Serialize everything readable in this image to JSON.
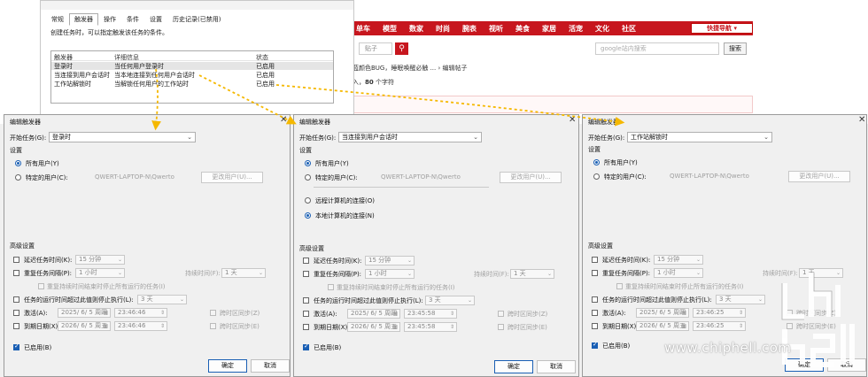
{
  "forum": {
    "nav_items": [
      "单车",
      "模型",
      "数家",
      "时尚",
      "腕表",
      "视听",
      "美食",
      "家居",
      "活宠",
      "文化",
      "社区"
    ],
    "quick_nav": "快捷导航",
    "search_placeholder": "贴子",
    "search_icon": "search-icon",
    "google_placeholder": "google站内搜索",
    "search_button": "搜索",
    "breadcrumb": "蓝颜色BUG，睡眠唤醒必触 ... › 编辑帖子",
    "char_count_prefix": "入",
    "char_count_value": "80",
    "char_count_suffix": "个字符",
    "accent_color": "#c7161e"
  },
  "props_window": {
    "tabs": [
      "常规",
      "触发器",
      "操作",
      "条件",
      "设置",
      "历史记录(已禁用)"
    ],
    "active_tab": "触发器",
    "description": "创建任务时，可以指定触发该任务的条件。",
    "columns": [
      "触发器",
      "详细信息",
      "状态"
    ],
    "rows": [
      {
        "trigger": "登录时",
        "detail": "当任何用户登录时",
        "status": "已启用"
      },
      {
        "trigger": "当连接到用户会话时",
        "detail": "当本地连接到任何用户会话时",
        "status": "已启用"
      },
      {
        "trigger": "工作站解锁时",
        "detail": "当解锁任何用户的工作站时",
        "status": "已启用"
      }
    ]
  },
  "dialogs": [
    {
      "title": "编辑触发器",
      "start_label": "开始任务(G):",
      "start_value": "登录时",
      "settings_label": "设置",
      "any_user": "所有用户(Y)",
      "specific_user": "特定的用户(C):",
      "user_name": "QWERT-LAPTOP-N\\Qwerto",
      "change_user": "更改用户(U)...",
      "advanced": "高级设置",
      "delay_label": "延迟任务时间(K):",
      "delay_value": "15 分钟",
      "repeat_label": "重复任务间隔(P):",
      "repeat_value": "1 小时",
      "duration_label": "持续时间(F):",
      "duration_value": "1 天",
      "stop_all": "重复持续时间结束时停止所有运行的任务(I)",
      "stop_if_label": "任务的运行时间超过此值则停止执行(L):",
      "stop_if_value": "3 天",
      "activate_label": "激活(A):",
      "activate_date": "2025/ 6/ 5 周四",
      "activate_time": "23:46:46",
      "expire_label": "到期日期(X):",
      "expire_date": "2026/ 6/ 5 周五",
      "expire_time": "23:46:46",
      "sync_zone": "跨时区同步(Z)",
      "sync_zone2": "跨时区同步(E)",
      "enabled": "已启用(B)",
      "ok": "确定",
      "cancel": "取消"
    },
    {
      "title": "编辑触发器",
      "start_label": "开始任务(G):",
      "start_value": "当连接到用户会话时",
      "settings_label": "设置",
      "any_user": "所有用户(Y)",
      "specific_user": "特定的用户(C):",
      "user_name": "QWERT-LAPTOP-N\\Qwerto",
      "change_user": "更改用户(U)...",
      "remote": "远程计算机的连接(O)",
      "local": "本地计算机的连接(N)",
      "advanced": "高级设置",
      "delay_label": "延迟任务时间(K):",
      "delay_value": "15 分钟",
      "repeat_label": "重复任务间隔(P):",
      "repeat_value": "1 小时",
      "duration_label": "持续时间(F):",
      "duration_value": "1 天",
      "stop_all": "重复持续时间结束时停止所有运行的任务(I)",
      "stop_if_label": "任务的运行时间超过此值则停止执行(L):",
      "stop_if_value": "3 天",
      "activate_label": "激活(A):",
      "activate_date": "2025/ 6/ 5 周四",
      "activate_time": "23:45:58",
      "expire_label": "到期日期(X):",
      "expire_date": "2026/ 6/ 5 周五",
      "expire_time": "23:45:58",
      "sync_zone": "跨时区同步(Z)",
      "sync_zone2": "跨时区同步(E)",
      "enabled": "已启用(B)",
      "ok": "确定",
      "cancel": "取消"
    },
    {
      "title": "编辑触发器",
      "start_label": "开始任务(G):",
      "start_value": "工作站解锁时",
      "settings_label": "设置",
      "any_user": "所有用户(Y)",
      "specific_user": "特定的用户(C):",
      "user_name": "QWERT-LAPTOP-N\\Qwerto",
      "change_user": "更改用户(U)...",
      "advanced": "高级设置",
      "delay_label": "延迟任务时间(K):",
      "delay_value": "15 分钟",
      "repeat_label": "重复任务间隔(P):",
      "repeat_value": "1 小时",
      "duration_label": "持续时间(F):",
      "duration_value": "1 天",
      "stop_all": "重复持续时间结束时停止所有运行的任务(I)",
      "stop_if_label": "任务的运行时间超过此值则停止执行(L):",
      "stop_if_value": "3 天",
      "activate_label": "激活(A):",
      "activate_date": "2025/ 6/ 5 周四",
      "activate_time": "23:46:25",
      "expire_label": "到期日期(X):",
      "expire_date": "2026/ 6/ 5 周五",
      "expire_time": "23:46:25",
      "sync_zone": "跨时区同步(Z)",
      "sync_zone2": "跨时区同步(E)",
      "enabled": "已启用(B)",
      "ok": "确定",
      "cancel": "取消"
    }
  ],
  "watermark": {
    "url": "www.chiphell.com",
    "logo_icon": "chiphell-logo-icon"
  },
  "arrow_color": "#f5b800"
}
